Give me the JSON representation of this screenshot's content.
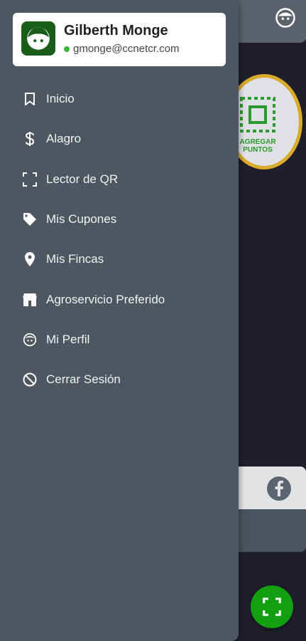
{
  "header": {
    "profile_icon": "face-icon"
  },
  "points_badge": {
    "line1": "AGREGAR",
    "line2": "PUNTOS",
    "icon": "qr-add-icon"
  },
  "social": {
    "icon": "facebook-icon"
  },
  "fab": {
    "icon": "scan-icon",
    "color": "#12a012"
  },
  "user": {
    "name": "Gilberth Monge",
    "email": "gmonge@ccnetcr.com",
    "status_color": "#3bb33b"
  },
  "menu": {
    "items": [
      {
        "label": "Inicio",
        "icon": "bookmark-icon"
      },
      {
        "label": "Alagro",
        "icon": "dollar-icon"
      },
      {
        "label": "Lector de QR",
        "icon": "qr-scan-icon"
      },
      {
        "label": "Mis Cupones",
        "icon": "tag-icon"
      },
      {
        "label": "Mis Fincas",
        "icon": "location-pin-icon"
      },
      {
        "label": "Agroservicio Preferido",
        "icon": "store-icon"
      },
      {
        "label": "Mi Perfil",
        "icon": "face-icon"
      },
      {
        "label": "Cerrar Sesión",
        "icon": "block-icon"
      }
    ]
  },
  "colors": {
    "drawer": "#4c5762",
    "accent_green": "#12a012",
    "badge_border": "#d9ab2c"
  }
}
